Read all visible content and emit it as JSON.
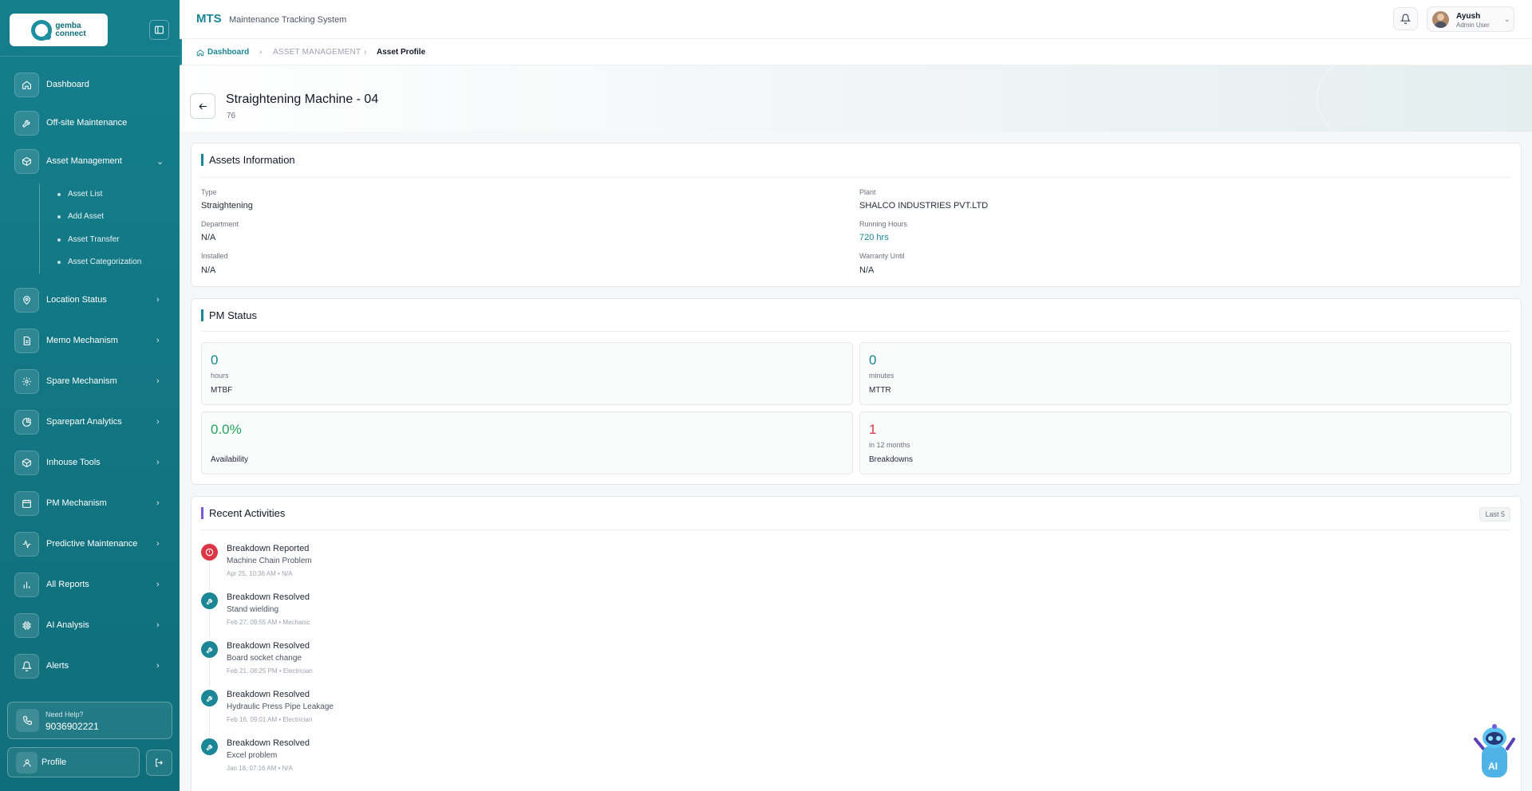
{
  "brand": {
    "logo_line1": "gemba",
    "logo_line2": "connect"
  },
  "app": {
    "title": "MTS",
    "subtitle": "Maintenance Tracking System"
  },
  "user": {
    "name": "Ayush",
    "role": "Admin User"
  },
  "sidebar": {
    "items": [
      {
        "label": "Dashboard",
        "icon": "home-icon"
      },
      {
        "label": "Off-site Maintenance",
        "icon": "wrench-icon"
      },
      {
        "label": "Asset Management",
        "icon": "box-icon",
        "expanded": true
      },
      {
        "label": "Location Status",
        "icon": "map-pin-icon"
      },
      {
        "label": "Memo Mechanism",
        "icon": "document-icon"
      },
      {
        "label": "Spare Mechanism",
        "icon": "gear-icon"
      },
      {
        "label": "Sparepart Analytics",
        "icon": "pie-chart-icon"
      },
      {
        "label": "Inhouse Tools",
        "icon": "box-icon"
      },
      {
        "label": "PM Mechanism",
        "icon": "calendar-icon"
      },
      {
        "label": "Predictive Maintenance",
        "icon": "activity-icon"
      },
      {
        "label": "All Reports",
        "icon": "bar-chart-icon"
      },
      {
        "label": "AI Analysis",
        "icon": "cpu-icon"
      },
      {
        "label": "Alerts",
        "icon": "bell-icon"
      }
    ],
    "sub_items": [
      "Asset List",
      "Add Asset",
      "Asset Transfer",
      "Asset Categorization"
    ],
    "help": {
      "title": "Need Help?",
      "phone": "9036902221"
    },
    "profile_label": "Profile"
  },
  "breadcrumb": {
    "home": "Dashboard",
    "section": "ASSET MANAGEMENT",
    "current": "Asset Profile"
  },
  "asset": {
    "title": "Straightening Machine - 04",
    "id": "76"
  },
  "assets_info": {
    "title": "Assets Information",
    "type_label": "Type",
    "type_value": "Straightening",
    "plant_label": "Plant",
    "plant_value": "SHALCO INDUSTRIES PVT.LTD",
    "department_label": "Department",
    "department_value": "N/A",
    "running_label": "Running Hours",
    "running_value": "720 hrs",
    "installed_label": "Installed",
    "installed_value": "N/A",
    "warranty_label": "Warranty Until",
    "warranty_value": "N/A"
  },
  "pm_status": {
    "title": "PM Status",
    "mtbf": {
      "value": "0",
      "unit": "hours",
      "name": "MTBF"
    },
    "mttr": {
      "value": "0",
      "unit": "minutes",
      "name": "MTTR"
    },
    "availability": {
      "value": "0.0%",
      "name": "Availability"
    },
    "breakdowns": {
      "value": "1",
      "unit": "in 12 months",
      "name": "Breakdowns"
    }
  },
  "recent": {
    "title": "Recent Activities",
    "badge": "Last 5",
    "items": [
      {
        "title": "Breakdown Reported",
        "desc": "Machine Chain Problem",
        "meta": "Apr 25, 10:36 AM • N/A"
      },
      {
        "title": "Breakdown Resolved",
        "desc": "Stand wielding",
        "meta": "Feb 27, 09:55 AM • Mechanic"
      },
      {
        "title": "Breakdown Resolved",
        "desc": "Board socket change",
        "meta": "Feb 21, 08:25 PM • Electrician"
      },
      {
        "title": "Breakdown Resolved",
        "desc": "Hydraulic Press Pipe Leakage",
        "meta": "Feb 16, 09:01 AM • Electrician"
      },
      {
        "title": "Breakdown Resolved",
        "desc": "Excel problem",
        "meta": "Jan 18, 07:16 AM • N/A"
      }
    ]
  },
  "ai_badge": "AI",
  "colors": {
    "primary": "#1a8696",
    "sidebar": "#157e8c",
    "danger": "#dc3545",
    "success": "#22a65a"
  }
}
